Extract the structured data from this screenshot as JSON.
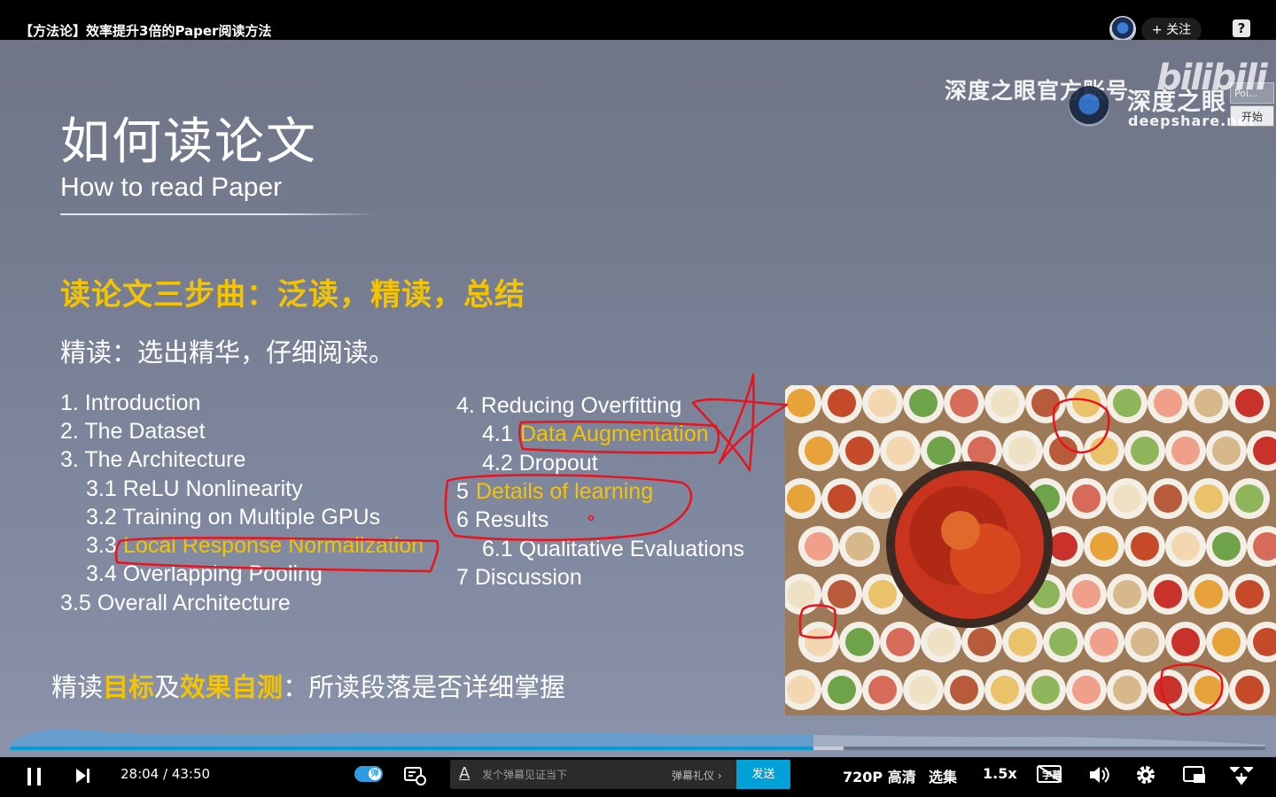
{
  "video": {
    "title": "【方法论】效率提升3倍的Paper阅读方法",
    "follow_label": "+ 关注",
    "help_label": "?",
    "side_tab_label": "Poi...",
    "side_start_label": "开始"
  },
  "slide": {
    "title": "如何读论文",
    "subtitle": "How to read Paper",
    "three_steps": "读论文三步曲：泛读，精读，总结",
    "intensive": "精读：选出精华，仔细阅读。",
    "toc_left": [
      "1. Introduction",
      "2. The Dataset",
      "3. The Architecture",
      "3.1 ReLU Nonlinearity",
      "3.2 Training on Multiple GPUs",
      "3.3",
      "Local Response Normalization",
      "3.4 Overlapping Pooling",
      "3.5 Overall Architecture"
    ],
    "toc_right": [
      "4. Reducing Overfitting",
      "4.1",
      "Data Augmentation",
      "4.2 Dropout",
      "5",
      "Details of learning",
      "6 Results",
      "6.1 Qualitative Evaluations",
      "7 Discussion"
    ],
    "bottom": {
      "p1": "精读",
      "p2": "目标",
      "p3": "及",
      "p4": "效果自测",
      "p5": "：所读段落是否详细掌握"
    },
    "watermark": {
      "channel": "深度之眼官方账号",
      "logo_text": "深度之眼",
      "url": "deepshare.net",
      "bili": "bilibili"
    },
    "colors": {
      "accent_yellow": "#f5c400",
      "annotation_red": "#e8141c"
    }
  },
  "player": {
    "time": "28:04 / 43:50",
    "progress": 0.641,
    "danmaku_toggle_label": "弹",
    "danmaku_placeholder": "发个弹幕见证当下",
    "danmaku_etiquette": "弹幕礼仪 ›",
    "send_label": "发送",
    "quality": "720P 高清",
    "episodes": "选集",
    "speed": "1.5x",
    "subtitle_icon_label": "字幕"
  }
}
